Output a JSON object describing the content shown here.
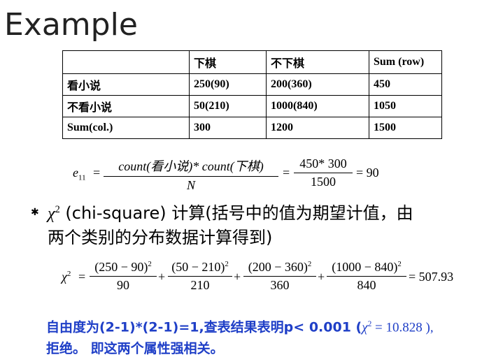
{
  "title": "Example",
  "table": {
    "header": [
      "",
      "下棋",
      "不下棋",
      "Sum (row)"
    ],
    "rows": [
      [
        "看小说",
        "250(90)",
        "200(360)",
        "450"
      ],
      [
        "不看小说",
        "50(210)",
        "1000(840)",
        "1050"
      ],
      [
        "Sum(col.)",
        "300",
        "1200",
        "1500"
      ]
    ]
  },
  "formula1": {
    "lhs": "e",
    "lhs_sub": "11",
    "eq1": "=",
    "num1": "count(看小说)* count(下棋)",
    "den1": "N",
    "eq2": "=",
    "num2": "450* 300",
    "den2": "1500",
    "result": "= 90"
  },
  "bullet": {
    "marker": "✱",
    "symbol": "χ",
    "sup": "2",
    "line1": " (chi-square) 计算(括号中的值为期望计值，由",
    "line2": "两个类别的分布数据计算得到)"
  },
  "formula2": {
    "lhs": "χ",
    "lhs_sup": "2",
    "eq": "=",
    "terms": [
      {
        "num": "(250 − 90)",
        "den": "90"
      },
      {
        "num": "(50 − 210)",
        "den": "210"
      },
      {
        "num": "(200 − 360)",
        "den": "360"
      },
      {
        "num": "(1000 − 840)",
        "den": "840"
      }
    ],
    "term_sup": "2",
    "plus": "+",
    "result": "= 507.93"
  },
  "conclusion": {
    "part1": "自由度为(2-1)*(2-1)=1,查表结果表明p< 0.001 (",
    "symbol": "χ",
    "sup": "2",
    "part2": " = 10.828 ),",
    "line2": "拒绝。 即这两个属性强相关。"
  },
  "colors": {
    "conclusion_text": "#1f3fc7",
    "text": "#000000"
  }
}
